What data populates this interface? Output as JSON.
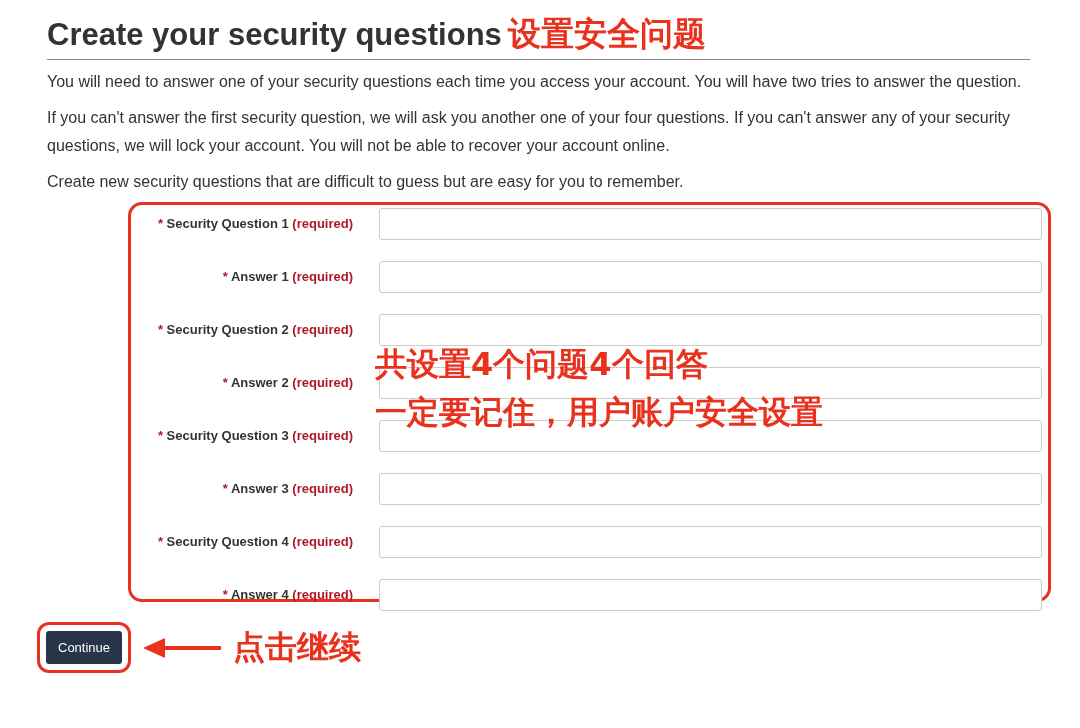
{
  "heading": {
    "title": "Create your security questions",
    "note": "设置安全问题"
  },
  "paragraphs": [
    "You will need to answer one of your security questions each time you access your account. You will have two tries to answer the question.",
    "If you can't answer the first security question, we will ask you another one of your four questions. If you can't answer any of your security questions, we will lock your account.  You will not be able to recover your account online.",
    "Create new security questions that are difficult to guess but are easy for you to remember."
  ],
  "fields": [
    {
      "marker": "*",
      "label": "Security Question 1",
      "hint": "(required)"
    },
    {
      "marker": "*",
      "label": "Answer 1",
      "hint": "(required)"
    },
    {
      "marker": "*",
      "label": "Security Question 2",
      "hint": "(required)"
    },
    {
      "marker": "*",
      "label": "Answer 2",
      "hint": "(required)"
    },
    {
      "marker": "*",
      "label": "Security Question 3",
      "hint": "(required)"
    },
    {
      "marker": "*",
      "label": "Answer 3",
      "hint": "(required)"
    },
    {
      "marker": "*",
      "label": "Security Question 4",
      "hint": "(required)"
    },
    {
      "marker": "*",
      "label": "Answer 4",
      "hint": "(required)"
    }
  ],
  "form_note": [
    "共设置4个问题4个回答",
    "一定要记住，用户账户安全设置"
  ],
  "button": {
    "label": "Continue",
    "note": "点击继续"
  }
}
